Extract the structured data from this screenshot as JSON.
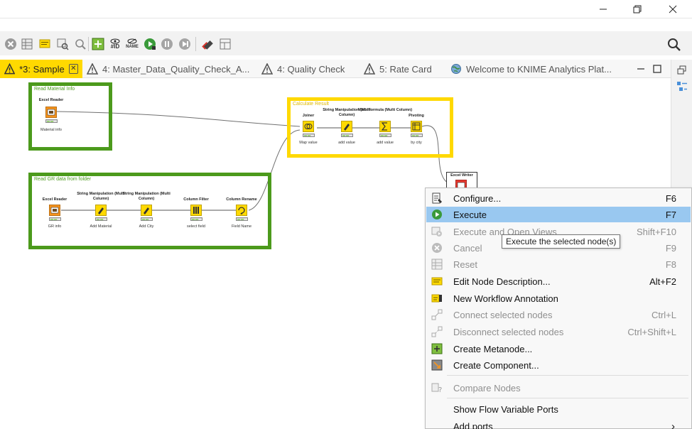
{
  "window": {
    "minimize_glyph": "—",
    "maximize_glyph": "❐",
    "close_glyph": "✕"
  },
  "toolbar": {
    "icons": [
      "cancel-all-icon",
      "reset-icon",
      "annotation-icon",
      "open-view-icon",
      "zoom-icon",
      "metanode-icon",
      "show-node-id-icon",
      "hide-node-name-icon",
      "execute-all-icon",
      "pause-icon",
      "step-icon",
      "wrench-icon",
      "layout-icon"
    ],
    "id_label": "#ID",
    "name_label": "NAME"
  },
  "tabs": [
    {
      "label": "*3: Sample",
      "active": true,
      "icon": "warning-icon"
    },
    {
      "label": "4: Master_Data_Quality_Check_A...",
      "active": false,
      "icon": "warning-icon"
    },
    {
      "label": "4: Quality Check",
      "active": false,
      "icon": "warning-icon"
    },
    {
      "label": "5: Rate Card",
      "active": false,
      "icon": "warning-icon"
    },
    {
      "label": "Welcome to KNIME Analytics Plat...",
      "active": false,
      "icon": "globe-icon"
    }
  ],
  "tab_close": "✕",
  "annotations": [
    {
      "label": "Read Material Info",
      "color": "#4c9a1c"
    },
    {
      "label": "Read GR data from folder",
      "color": "#4c9a1c"
    },
    {
      "label": "Calculate Result",
      "color": "#ffd900"
    }
  ],
  "nodes": [
    {
      "title": "Excel Reader",
      "label": "Material info",
      "color": "#f7941d",
      "glyph": "XLS"
    },
    {
      "title": "Excel Reader",
      "label": "GR info",
      "color": "#f7941d",
      "glyph": "XLS"
    },
    {
      "title": "String Manipulation (Multi Column)",
      "label": "Add Material",
      "color": "#ffd900",
      "glyph": "✎"
    },
    {
      "title": "String Manipulation (Multi Column)",
      "label": "Add City",
      "color": "#ffd900",
      "glyph": "✎"
    },
    {
      "title": "Column Filter",
      "label": "select field",
      "color": "#ffd900",
      "glyph": "⫶"
    },
    {
      "title": "Column Rename",
      "label": "Field Name",
      "color": "#ffd900",
      "glyph": "⟲"
    },
    {
      "title": "Joiner",
      "label": "Map value",
      "color": "#ffd900",
      "glyph": "⋈"
    },
    {
      "title": "String Manipulation (Multi Column)",
      "label": "add value",
      "color": "#ffd900",
      "glyph": "✎"
    },
    {
      "title": "Math Formula (Multi Column)",
      "label": "add value",
      "color": "#ffd900",
      "glyph": "∑"
    },
    {
      "title": "Pivoting",
      "label": "by city",
      "color": "#ffd900",
      "glyph": "▦"
    },
    {
      "title": "Excel Writer",
      "label": "",
      "color": "#e8392f",
      "glyph": "XLS"
    }
  ],
  "context_menu": {
    "items": [
      {
        "label": "Configure...",
        "shortcut": "F6",
        "enabled": true,
        "icon": "configure-icon"
      },
      {
        "label": "Execute",
        "shortcut": "F7",
        "enabled": true,
        "icon": "execute-icon",
        "hover": true
      },
      {
        "label": "Execute and Open Views",
        "shortcut": "Shift+F10",
        "enabled": false,
        "icon": "execute-open-views-icon"
      },
      {
        "label": "Cancel",
        "shortcut": "F9",
        "enabled": false,
        "icon": "cancel-icon"
      },
      {
        "label": "Reset",
        "shortcut": "F8",
        "enabled": false,
        "icon": "reset-icon"
      },
      {
        "label": "Edit Node Description...",
        "shortcut": "Alt+F2",
        "enabled": true,
        "icon": "edit-description-icon"
      },
      {
        "label": "New Workflow Annotation",
        "shortcut": "",
        "enabled": true,
        "icon": "annotation-icon"
      },
      {
        "label": "Connect selected nodes",
        "shortcut": "Ctrl+L",
        "enabled": false,
        "icon": "connect-icon"
      },
      {
        "label": "Disconnect selected nodes",
        "shortcut": "Ctrl+Shift+L",
        "enabled": false,
        "icon": "disconnect-icon"
      },
      {
        "label": "Create Metanode...",
        "shortcut": "",
        "enabled": true,
        "icon": "metanode-icon"
      },
      {
        "label": "Create Component...",
        "shortcut": "",
        "enabled": true,
        "icon": "component-icon"
      },
      {
        "label": "Compare Nodes",
        "shortcut": "",
        "enabled": false,
        "icon": "compare-icon"
      },
      {
        "label": "Show Flow Variable Ports",
        "shortcut": "",
        "enabled": true,
        "icon": ""
      },
      {
        "label": "Add ports",
        "shortcut": "",
        "enabled": true,
        "icon": "",
        "submenu": true
      }
    ],
    "submenu_glyph": "›"
  },
  "tooltip": "Execute the selected node(s)",
  "colors": {
    "active_tab": "#ffd900",
    "hover": "#99c8f0",
    "green_annotation": "#4c9a1c",
    "yellow_annotation": "#ffd900"
  }
}
